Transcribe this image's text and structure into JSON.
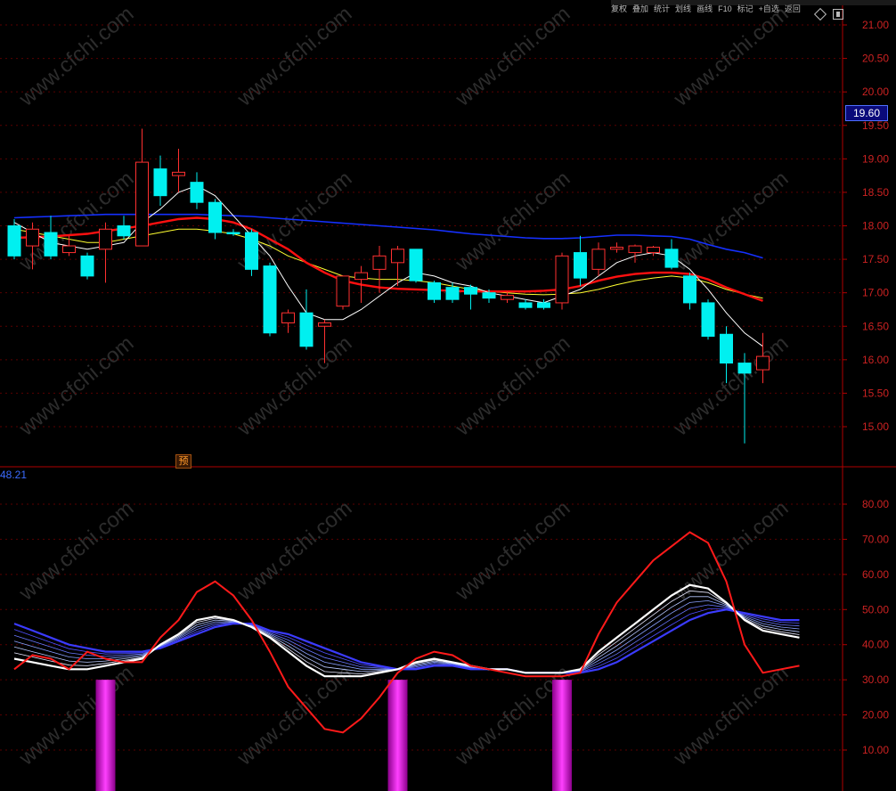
{
  "top_bar": {
    "items": [
      "复权",
      "叠加",
      "统计",
      "划线",
      "画线",
      "F10",
      "标记",
      "+自选",
      "返回"
    ]
  },
  "current_price_label": "19.60",
  "indicator_value_label": "48.21",
  "forecast_label": "预",
  "watermark": "www.cfchi.com",
  "colors": {
    "background": "#000000",
    "up_candle": "#ff3030",
    "down_candle": "#00f0f0",
    "ma_short": "#ffffff",
    "ma_mid": "#ffff30",
    "ma_red": "#ff1010",
    "ma_blue": "#1530ff",
    "indicator_red": "#ff1a1a",
    "indicator_white": "#ffffff",
    "indicator_blue": "#3b3bff",
    "histogram": "#d020e0",
    "axis_red": "#b00000",
    "axis_text": "#cc2222"
  },
  "chart_data": [
    {
      "type": "candlestick",
      "ylim": [
        14.5,
        21.2
      ],
      "y_ticks": [
        "21.00",
        "20.50",
        "20.00",
        "19.50",
        "19.00",
        "18.50",
        "18.00",
        "17.50",
        "17.00",
        "16.50",
        "16.00",
        "15.50",
        "15.00"
      ],
      "candles": [
        {
          "o": 18.0,
          "h": 18.1,
          "l": 17.5,
          "c": 17.55
        },
        {
          "o": 17.7,
          "h": 18.05,
          "l": 17.35,
          "c": 17.95
        },
        {
          "o": 17.9,
          "h": 18.15,
          "l": 17.5,
          "c": 17.55
        },
        {
          "o": 17.6,
          "h": 17.85,
          "l": 17.55,
          "c": 17.7
        },
        {
          "o": 17.55,
          "h": 17.6,
          "l": 17.2,
          "c": 17.25
        },
        {
          "o": 17.65,
          "h": 18.05,
          "l": 17.15,
          "c": 17.95
        },
        {
          "o": 18.0,
          "h": 18.15,
          "l": 17.8,
          "c": 17.85
        },
        {
          "o": 17.7,
          "h": 19.45,
          "l": 17.7,
          "c": 18.95
        },
        {
          "o": 18.85,
          "h": 19.05,
          "l": 18.3,
          "c": 18.45
        },
        {
          "o": 18.75,
          "h": 19.15,
          "l": 18.5,
          "c": 18.8
        },
        {
          "o": 18.65,
          "h": 18.8,
          "l": 18.25,
          "c": 18.35
        },
        {
          "o": 18.35,
          "h": 18.4,
          "l": 17.8,
          "c": 17.9
        },
        {
          "o": 17.9,
          "h": 17.95,
          "l": 17.85,
          "c": 17.88
        },
        {
          "o": 17.9,
          "h": 17.95,
          "l": 17.25,
          "c": 17.35
        },
        {
          "o": 17.4,
          "h": 17.45,
          "l": 16.35,
          "c": 16.4
        },
        {
          "o": 16.55,
          "h": 16.75,
          "l": 16.4,
          "c": 16.7
        },
        {
          "o": 16.7,
          "h": 17.05,
          "l": 16.15,
          "c": 16.2
        },
        {
          "o": 16.5,
          "h": 16.6,
          "l": 15.95,
          "c": 16.55
        },
        {
          "o": 16.8,
          "h": 17.25,
          "l": 16.75,
          "c": 17.25
        },
        {
          "o": 17.2,
          "h": 17.4,
          "l": 16.85,
          "c": 17.3
        },
        {
          "o": 17.35,
          "h": 17.7,
          "l": 17.0,
          "c": 17.55
        },
        {
          "o": 17.45,
          "h": 17.7,
          "l": 17.1,
          "c": 17.65
        },
        {
          "o": 17.65,
          "h": 17.65,
          "l": 17.15,
          "c": 17.18
        },
        {
          "o": 17.15,
          "h": 17.18,
          "l": 16.85,
          "c": 16.9
        },
        {
          "o": 17.08,
          "h": 17.15,
          "l": 16.85,
          "c": 16.9
        },
        {
          "o": 17.08,
          "h": 17.12,
          "l": 16.75,
          "c": 16.98
        },
        {
          "o": 17.0,
          "h": 17.05,
          "l": 16.85,
          "c": 16.92
        },
        {
          "o": 16.9,
          "h": 17.02,
          "l": 16.85,
          "c": 16.96
        },
        {
          "o": 16.85,
          "h": 16.9,
          "l": 16.75,
          "c": 16.78
        },
        {
          "o": 16.85,
          "h": 16.9,
          "l": 16.75,
          "c": 16.78
        },
        {
          "o": 16.85,
          "h": 17.6,
          "l": 16.75,
          "c": 17.55
        },
        {
          "o": 17.6,
          "h": 17.85,
          "l": 17.1,
          "c": 17.22
        },
        {
          "o": 17.35,
          "h": 17.75,
          "l": 17.25,
          "c": 17.65
        },
        {
          "o": 17.65,
          "h": 17.75,
          "l": 17.6,
          "c": 17.68
        },
        {
          "o": 17.6,
          "h": 17.72,
          "l": 17.45,
          "c": 17.7
        },
        {
          "o": 17.6,
          "h": 17.7,
          "l": 17.55,
          "c": 17.68
        },
        {
          "o": 17.65,
          "h": 17.8,
          "l": 17.35,
          "c": 17.38
        },
        {
          "o": 17.25,
          "h": 17.3,
          "l": 16.75,
          "c": 16.85
        },
        {
          "o": 16.85,
          "h": 16.9,
          "l": 16.3,
          "c": 16.35
        },
        {
          "o": 16.38,
          "h": 16.5,
          "l": 15.65,
          "c": 15.95
        },
        {
          "o": 15.95,
          "h": 16.1,
          "l": 14.75,
          "c": 15.8
        },
        {
          "o": 15.85,
          "h": 16.4,
          "l": 15.65,
          "c": 16.05
        }
      ],
      "ma_short": [
        18.05,
        17.9,
        17.75,
        17.7,
        17.65,
        17.7,
        17.75,
        18.05,
        18.25,
        18.5,
        18.6,
        18.45,
        18.15,
        17.85,
        17.55,
        17.1,
        16.7,
        16.6,
        16.6,
        16.75,
        16.95,
        17.15,
        17.3,
        17.25,
        17.15,
        17.1,
        17.0,
        16.95,
        16.9,
        16.85,
        16.95,
        17.05,
        17.25,
        17.45,
        17.55,
        17.6,
        17.55,
        17.35,
        17.05,
        16.7,
        16.4,
        16.2
      ],
      "ma_mid": [
        17.95,
        17.9,
        17.85,
        17.8,
        17.75,
        17.75,
        17.8,
        17.85,
        17.9,
        17.95,
        17.95,
        17.92,
        17.88,
        17.8,
        17.7,
        17.55,
        17.45,
        17.35,
        17.25,
        17.22,
        17.2,
        17.2,
        17.18,
        17.15,
        17.1,
        17.05,
        17.02,
        17.0,
        16.98,
        16.97,
        16.98,
        17.0,
        17.05,
        17.12,
        17.18,
        17.22,
        17.25,
        17.22,
        17.15,
        17.05,
        16.98,
        16.92
      ],
      "ma_red": [
        17.82,
        17.83,
        17.84,
        17.86,
        17.88,
        17.92,
        17.96,
        18.0,
        18.05,
        18.1,
        18.12,
        18.1,
        18.05,
        17.95,
        17.8,
        17.65,
        17.45,
        17.3,
        17.18,
        17.12,
        17.08,
        17.06,
        17.05,
        17.04,
        17.03,
        17.02,
        17.02,
        17.02,
        17.02,
        17.03,
        17.05,
        17.1,
        17.18,
        17.24,
        17.28,
        17.3,
        17.3,
        17.28,
        17.2,
        17.08,
        16.98,
        16.88
      ],
      "ma_blue": [
        18.12,
        18.13,
        18.14,
        18.15,
        18.16,
        18.17,
        18.17,
        18.17,
        18.17,
        18.17,
        18.17,
        18.16,
        18.15,
        18.14,
        18.12,
        18.1,
        18.08,
        18.06,
        18.04,
        18.02,
        18.0,
        17.98,
        17.96,
        17.94,
        17.91,
        17.88,
        17.86,
        17.84,
        17.82,
        17.81,
        17.81,
        17.82,
        17.84,
        17.86,
        17.86,
        17.85,
        17.84,
        17.8,
        17.72,
        17.65,
        17.6,
        17.52
      ]
    },
    {
      "type": "line",
      "ylim": [
        5,
        90
      ],
      "y_ticks": [
        "80.00",
        "70.00",
        "60.00",
        "50.00",
        "40.00",
        "30.00",
        "20.00",
        "10.00"
      ],
      "series": [
        {
          "values": [
            33,
            37,
            36,
            33,
            38,
            36,
            35,
            35,
            42,
            47,
            55,
            58,
            54,
            47,
            38,
            28,
            22,
            16,
            15,
            19,
            25,
            32,
            36,
            38,
            37,
            34,
            33,
            32,
            31,
            31,
            31,
            32,
            43,
            52,
            58,
            64,
            68,
            72,
            69,
            58,
            40,
            32,
            33,
            34
          ]
        },
        {
          "values": [
            36,
            35,
            34,
            33,
            33,
            34,
            35,
            36,
            40,
            43,
            47,
            48,
            47,
            45,
            42,
            38,
            34,
            31,
            31,
            31,
            32,
            33,
            35,
            36,
            35,
            34,
            33,
            33,
            32,
            32,
            32,
            33,
            38,
            42,
            46,
            50,
            54,
            57,
            56,
            52,
            47,
            44,
            43,
            42
          ]
        },
        {
          "values": [
            46,
            44,
            42,
            40,
            39,
            38,
            38,
            38,
            39,
            41,
            43,
            45,
            46,
            46,
            44,
            43,
            41,
            39,
            37,
            35,
            34,
            33,
            33,
            34,
            34,
            33,
            33,
            33,
            32,
            32,
            32,
            32,
            33,
            35,
            38,
            41,
            44,
            47,
            49,
            50,
            49,
            48,
            47,
            47
          ]
        }
      ],
      "histogram": [
        {
          "index": 5,
          "value": 30
        },
        {
          "index": 21,
          "value": 30
        },
        {
          "index": 30,
          "value": 30
        }
      ]
    }
  ]
}
